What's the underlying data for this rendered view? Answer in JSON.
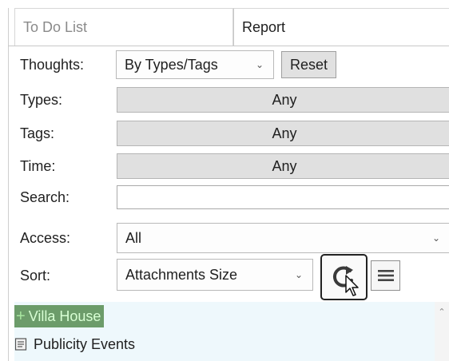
{
  "tabs": {
    "todo": "To Do List",
    "report": "Report"
  },
  "filters": {
    "thoughts_label": "Thoughts:",
    "thoughts_value": "By Types/Tags",
    "reset_label": "Reset",
    "types_label": "Types:",
    "types_value": "Any",
    "tags_label": "Tags:",
    "tags_value": "Any",
    "time_label": "Time:",
    "time_value": "Any",
    "search_label": "Search:",
    "search_value": "",
    "access_label": "Access:",
    "access_value": "All",
    "sort_label": "Sort:",
    "sort_value": "Attachments Size"
  },
  "icons": {
    "dropdown": "chevron-down-icon",
    "refresh": "refresh-icon",
    "menu": "hamburger-icon",
    "cursor": "mouse-pointer-icon",
    "add": "plus-icon",
    "document": "document-icon"
  },
  "results": {
    "items": [
      {
        "label": "Villa House"
      },
      {
        "label": "Publicity Events"
      }
    ]
  },
  "colors": {
    "selected_bg": "#6c9c6a",
    "selected_text": "#d8ffd4",
    "list_bg": "#eef8fc"
  }
}
